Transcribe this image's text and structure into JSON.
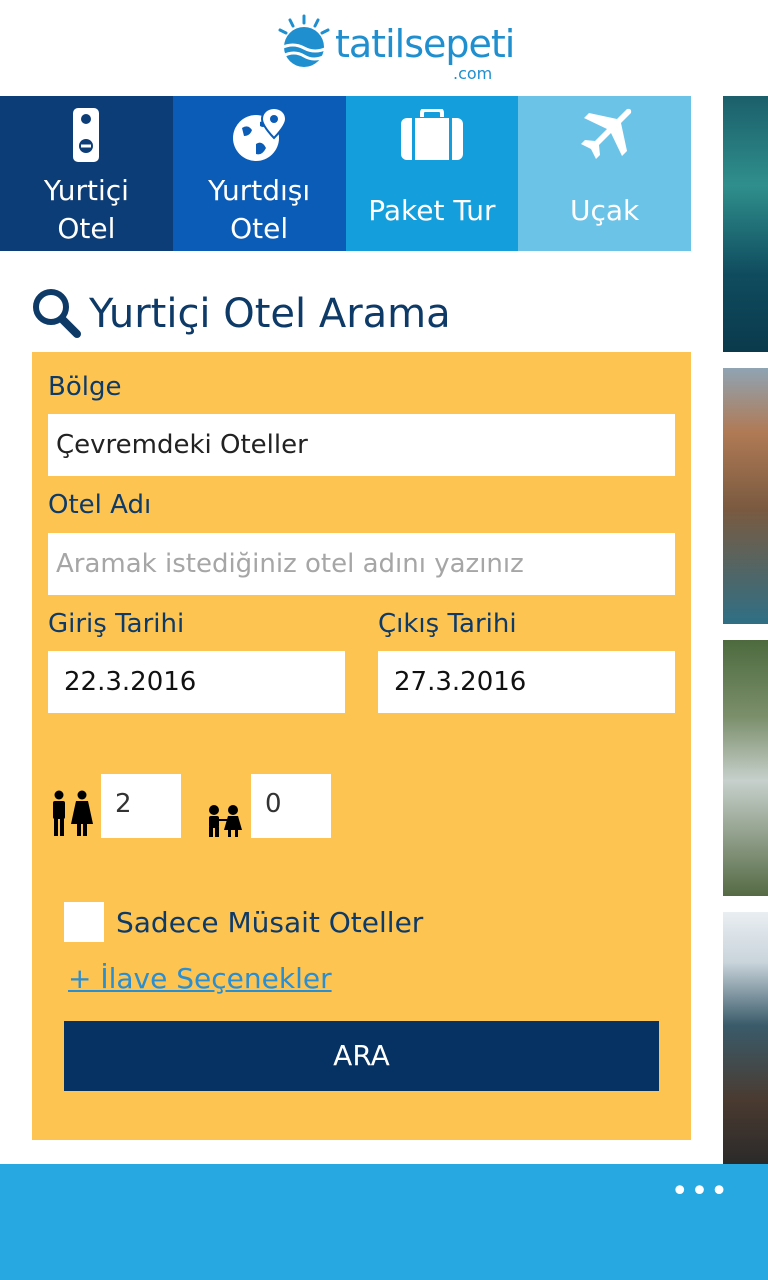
{
  "header": {
    "logo_text": "tatilsepeti",
    "logo_sub": ".com"
  },
  "tabs": [
    {
      "label_line1": "Yurtiçi",
      "label_line2": "Otel",
      "icon": "door-hanger-icon"
    },
    {
      "label_line1": "Yurtdışı",
      "label_line2": "Otel",
      "icon": "globe-pin-icon"
    },
    {
      "label": "Paket Tur",
      "icon": "suitcase-icon"
    },
    {
      "label": "Uçak",
      "icon": "airplane-icon"
    }
  ],
  "search": {
    "title": "Yurtiçi Otel Arama",
    "region_label": "Bölge",
    "region_value": "Çevremdeki Oteller",
    "hotel_label": "Otel Adı",
    "hotel_placeholder": "Aramak istediğiniz otel adını yazınız",
    "checkin_label": "Giriş Tarihi",
    "checkin_value": "22.3.2016",
    "checkout_label": "Çıkış Tarihi",
    "checkout_value": "27.3.2016",
    "adults_value": "2",
    "children_value": "0",
    "available_only_label": "Sadece Müsait Oteller",
    "more_options_label": "+ İlave Seçenekler",
    "search_button": "ARA"
  },
  "appbar": {
    "more_label": "•••"
  },
  "colors": {
    "tab1": "#0d3d77",
    "tab2": "#0b5cb7",
    "tab3": "#149fdc",
    "tab4": "#6cc3e8",
    "panel": "#fdc452",
    "button": "#053163",
    "appbar": "#27a8e0"
  }
}
